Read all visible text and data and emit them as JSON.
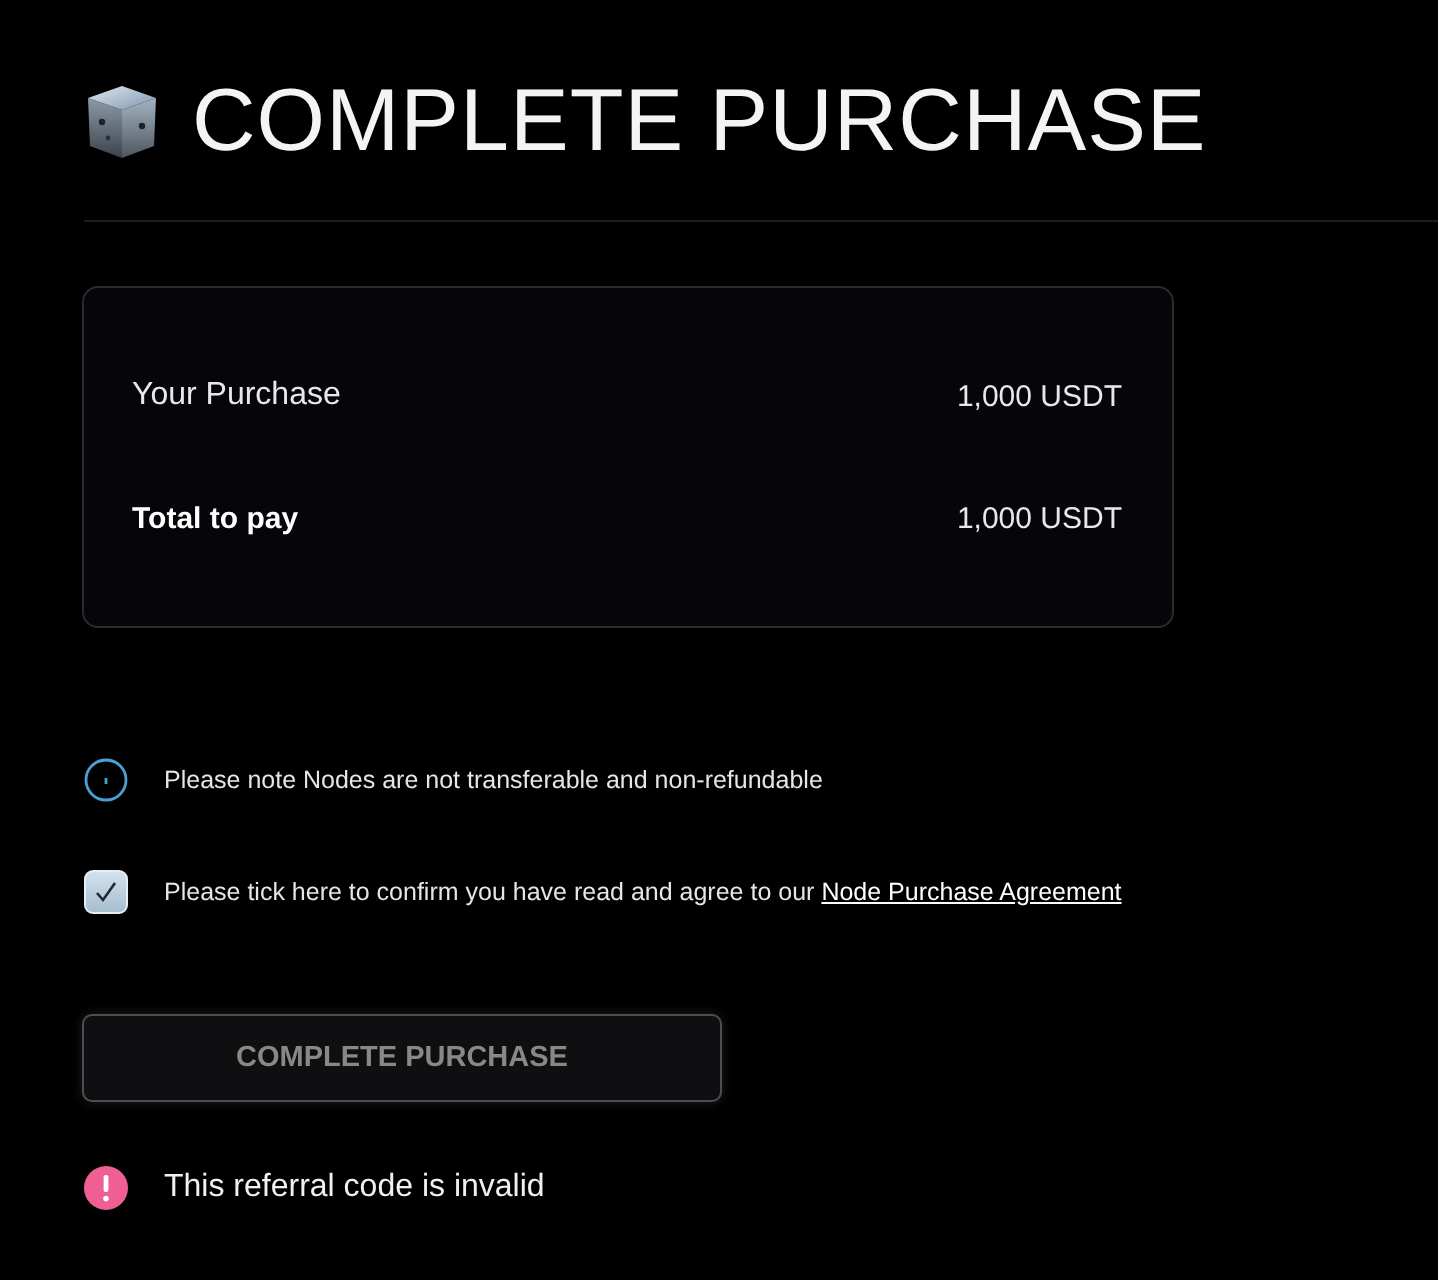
{
  "header": {
    "title": "COMPLETE PURCHASE"
  },
  "summary": {
    "rows": [
      {
        "kind": "item",
        "label": "Your Purchase",
        "value": "1,000 USDT"
      },
      {
        "kind": "total",
        "label": "Total to pay",
        "value": "1,000 USDT"
      }
    ]
  },
  "notice": {
    "text": "Please note Nodes are not transferable and non-refundable"
  },
  "agreement": {
    "checked": true,
    "text": "Please tick here to confirm you have read and agree to our",
    "link": "Node Purchase Agreement"
  },
  "purchase_button": {
    "label": "COMPLETE PURCHASE",
    "disabled": true
  },
  "error": {
    "text": "This referral code is invalid"
  }
}
